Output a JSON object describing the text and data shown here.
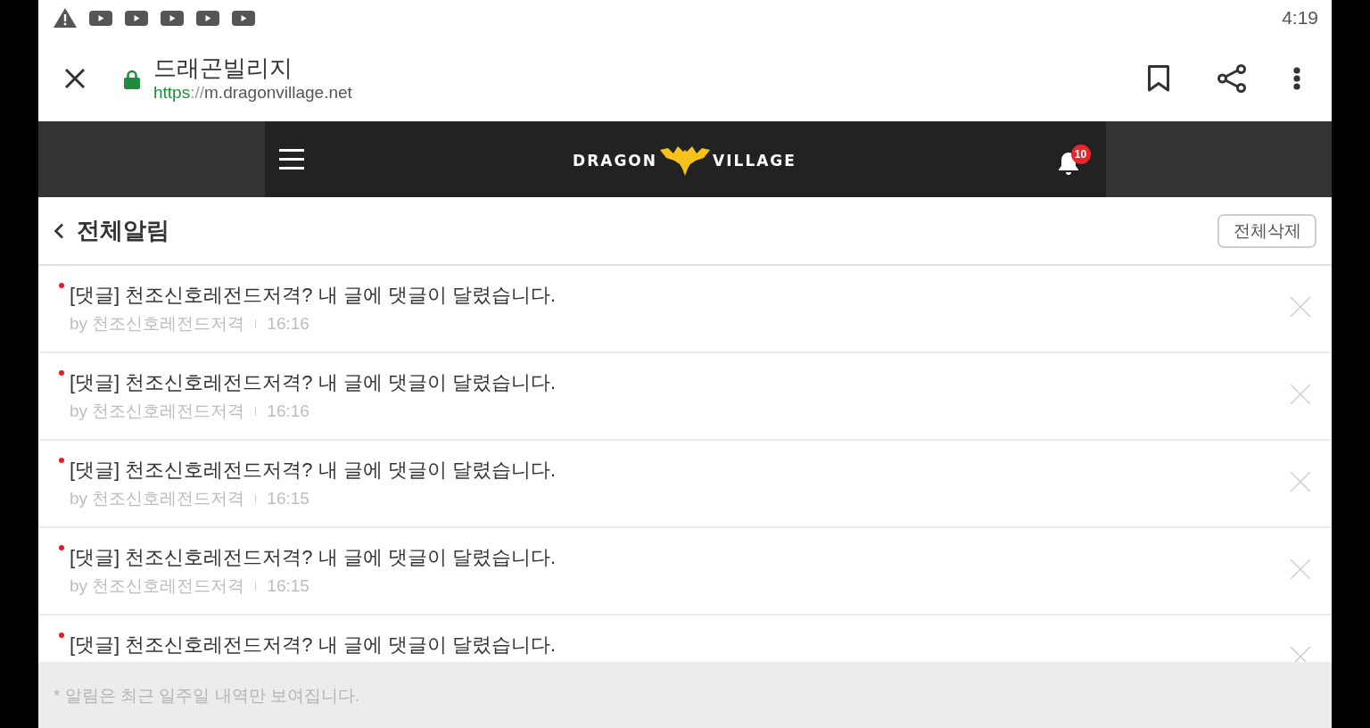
{
  "status_bar": {
    "time": "4:19"
  },
  "browser_bar": {
    "title": "드래곤빌리지",
    "url": {
      "scheme": "https",
      "separator": "://",
      "host": "m.dragonvillage.net"
    }
  },
  "site_header": {
    "logo": {
      "left": "DRAGON",
      "right": "VILLAGE"
    },
    "notification_badge": "10"
  },
  "page": {
    "title": "전체알림",
    "delete_all_button": "전체삭제"
  },
  "notifications": [
    {
      "title": "[댓글] 천조신호레전드저격? 내 글에 댓글이 달렸습니다.",
      "author": "by 천조신호레전드저격",
      "time": "16:16",
      "unread": true
    },
    {
      "title": "[댓글] 천조신호레전드저격? 내 글에 댓글이 달렸습니다.",
      "author": "by 천조신호레전드저격",
      "time": "16:16",
      "unread": true
    },
    {
      "title": "[댓글] 천조신호레전드저격? 내 글에 댓글이 달렸습니다.",
      "author": "by 천조신호레전드저격",
      "time": "16:15",
      "unread": true
    },
    {
      "title": "[댓글] 천조신호레전드저격? 내 글에 댓글이 달렸습니다.",
      "author": "by 천조신호레전드저격",
      "time": "16:15",
      "unread": true
    },
    {
      "title": "[댓글] 천조신호레전드저격? 내 글에 댓글이 달렸습니다.",
      "unread": true
    }
  ],
  "footer_note": "* 알림은 최근 일주일 내역만 보여집니다."
}
